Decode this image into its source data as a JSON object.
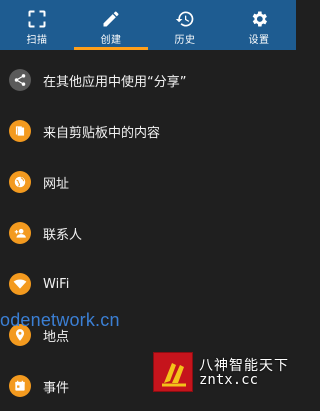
{
  "tabs": [
    {
      "label": "扫描",
      "icon": "scan-icon",
      "active": false
    },
    {
      "label": "创建",
      "icon": "pencil-icon",
      "active": true
    },
    {
      "label": "历史",
      "icon": "history-icon",
      "active": false
    },
    {
      "label": "设置",
      "icon": "gear-icon",
      "active": false
    }
  ],
  "items": [
    {
      "label": "在其他应用中使用“分享”",
      "icon": "share-icon",
      "color": "#5a5a5a"
    },
    {
      "label": "来自剪贴板中的内容",
      "icon": "clipboard-icon",
      "color": "#f39a1f"
    },
    {
      "label": "网址",
      "icon": "globe-icon",
      "color": "#f39a1f"
    },
    {
      "label": "联系人",
      "icon": "contact-icon",
      "color": "#f39a1f"
    },
    {
      "label": "WiFi",
      "icon": "wifi-icon",
      "color": "#f39a1f"
    },
    {
      "label": "地点",
      "icon": "location-icon",
      "color": "#f39a1f"
    },
    {
      "label": "事件",
      "icon": "calendar-icon",
      "color": "#f39a1f"
    }
  ],
  "watermark": {
    "site": "odenetwork.cn",
    "logo_line1": "八神智能天下",
    "logo_line2": "zntx.cc"
  },
  "colors": {
    "topbar": "#1e5c91",
    "accent": "#ff9f1a",
    "background": "#1f1f1f"
  }
}
